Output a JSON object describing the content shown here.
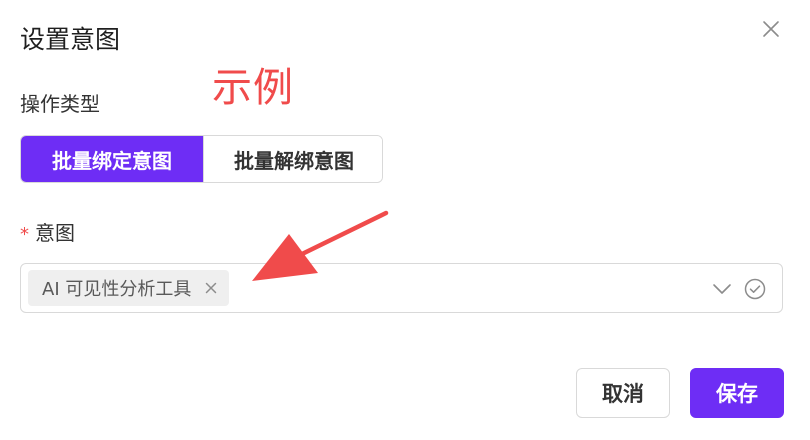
{
  "dialog": {
    "title": "设置意图",
    "close_icon": "close-icon"
  },
  "annotation": {
    "label": "示例",
    "color": "#f04b4b"
  },
  "operation": {
    "label": "操作类型",
    "options": [
      {
        "label": "批量绑定意图",
        "selected": true
      },
      {
        "label": "批量解绑意图",
        "selected": false
      }
    ]
  },
  "intent": {
    "required_mark": "*",
    "label": "意图",
    "selected_tags": [
      {
        "label": "AI 可见性分析工具"
      }
    ],
    "dropdown_icon": "chevron-down-icon",
    "status_icon": "check-circle-icon"
  },
  "footer": {
    "cancel_label": "取消",
    "save_label": "保存"
  },
  "theme": {
    "accent": "#6e2df5",
    "border": "#d9d9d9",
    "tag_bg": "#efefef"
  }
}
